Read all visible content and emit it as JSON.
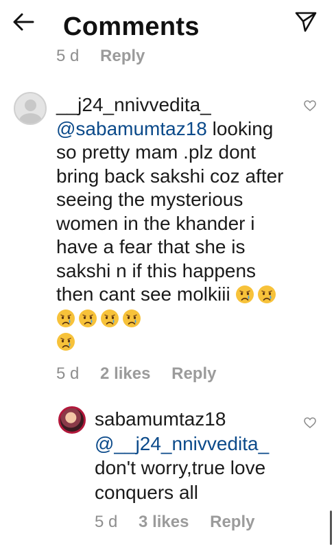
{
  "header": {
    "title": "Comments",
    "back_icon": "arrow-left-icon",
    "send_icon": "paper-plane-icon"
  },
  "previous_comment": {
    "time": "5 d",
    "reply_label": "Reply"
  },
  "comments": [
    {
      "username": "__j24_nnivvedita_",
      "mention": "@sabamumtaz18",
      "text": " looking so pretty mam .plz dont bring back sakshi coz after seeing the mysterious women in the khander i have a fear that she is sakshi n if this happens then cant see molkiii ",
      "emoji": "crying-face",
      "emoji_count": 7,
      "time": "5 d",
      "likes": "2 likes",
      "reply_label": "Reply"
    },
    {
      "username": "sabamumtaz18",
      "mention": "@__j24_nnivvedita_",
      "text": "don't worry,true love conquers all",
      "time": "5 d",
      "likes": "3 likes",
      "reply_label": "Reply"
    }
  ],
  "colors": {
    "mention": "#0b4a8a",
    "meta": "#8e8e8e",
    "story_ring": "#b2183b"
  }
}
